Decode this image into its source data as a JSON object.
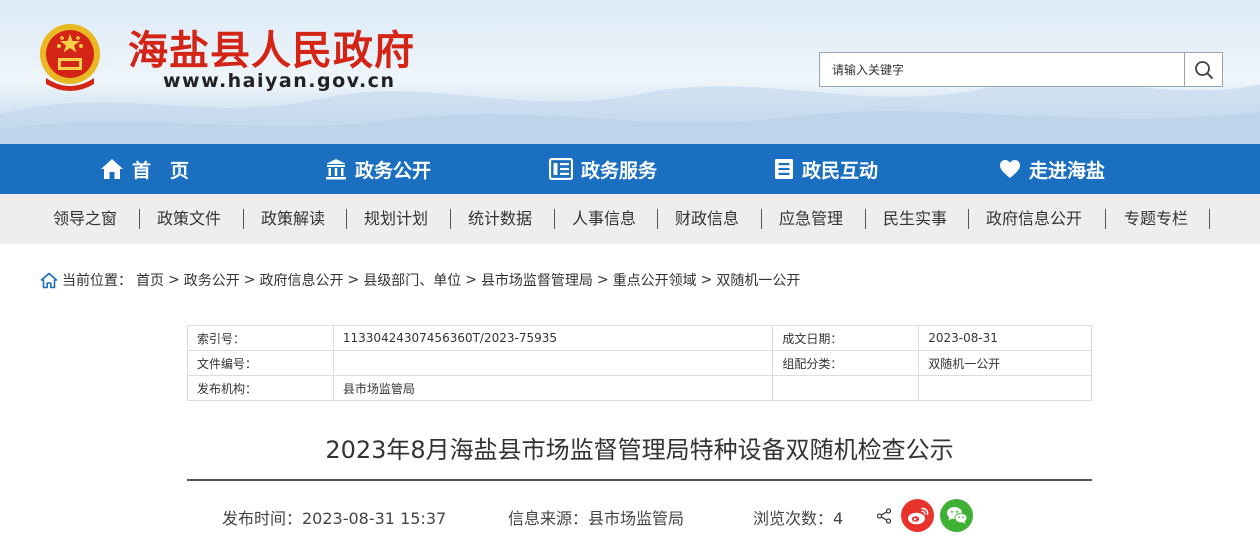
{
  "header": {
    "site_title": "海盐县人民政府",
    "site_url": "www.haiyan.gov.cn",
    "search_placeholder": "请输入关键字"
  },
  "main_nav": [
    {
      "label": "首　页",
      "icon": "home-icon"
    },
    {
      "label": "政务公开",
      "icon": "government-building-icon"
    },
    {
      "label": "政务服务",
      "icon": "service-list-icon"
    },
    {
      "label": "政民互动",
      "icon": "document-icon"
    },
    {
      "label": "走进海盐",
      "icon": "heart-icon"
    }
  ],
  "sub_nav": [
    "领导之窗",
    "政策文件",
    "政策解读",
    "规划计划",
    "统计数据",
    "人事信息",
    "财政信息",
    "应急管理",
    "民生实事",
    "政府信息公开",
    "专题专栏"
  ],
  "breadcrumb": {
    "prefix": "当前位置：",
    "items": [
      "首页",
      "政务公开",
      "政府信息公开",
      "县级部门、单位",
      "县市场监督管理局",
      "重点公开领域",
      "双随机一公开"
    ]
  },
  "info": {
    "index_label": "索引号：",
    "index_value": "11330424307456360T/2023-75935",
    "date_label": "成文日期：",
    "date_value": "2023-08-31",
    "doc_label": "文件编号：",
    "doc_value": "",
    "category_label": "组配分类：",
    "category_value": "双随机一公开",
    "publisher_label": "发布机构：",
    "publisher_value": "县市场监管局"
  },
  "article": {
    "title": "2023年8月海盐县市场监督管理局特种设备双随机检查公示",
    "publish_time": "发布时间：2023-08-31 15:37",
    "source": "信息来源：县市场监管局",
    "views": "浏览次数：4"
  },
  "colors": {
    "brand_red": "#d42416",
    "nav_blue": "#1a6fc1",
    "weibo_red": "#e7332c",
    "wechat_green": "#3eb135"
  }
}
